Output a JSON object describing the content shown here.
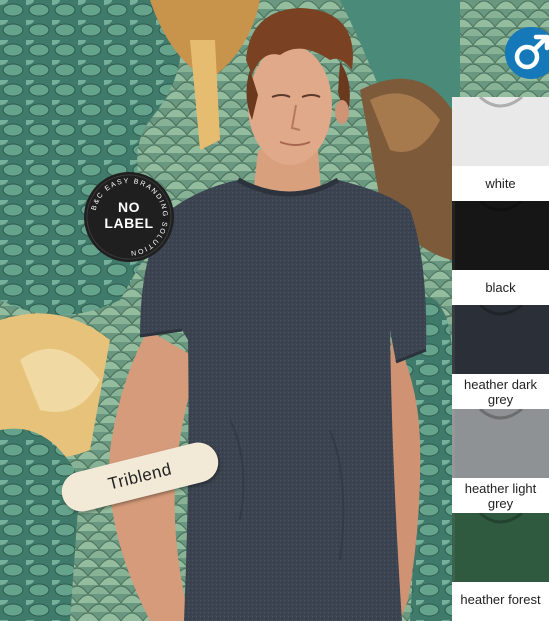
{
  "badge": {
    "line1": "NO",
    "line2": "LABEL",
    "ring_text": "B&C EASY BRANDING SOLUTION"
  },
  "fabric_label": "Triblend",
  "gender_icon": "male-symbol-icon",
  "colors": [
    {
      "label": "white",
      "hex": "#e9e9e9"
    },
    {
      "label": "black",
      "hex": "#161616"
    },
    {
      "label": "heather dark grey",
      "hex": "#2b3038"
    },
    {
      "label": "heather light grey",
      "hex": "#8f9294"
    },
    {
      "label": "heather forest",
      "hex": "#2f5a3f"
    }
  ],
  "palette": {
    "brand_blue": "#1578b8",
    "shirt": "#3a4350",
    "mural_teal": "#5f9a86",
    "mural_ochre": "#d9a85d"
  }
}
